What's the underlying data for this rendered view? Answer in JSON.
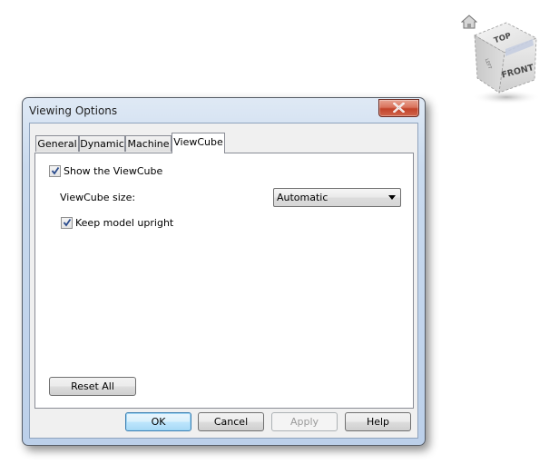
{
  "viewcube": {
    "top_label": "TOP",
    "front_label": "FRONT",
    "left_label": "LEFT",
    "home_icon": "home-icon"
  },
  "dialog": {
    "title": "Viewing Options",
    "close_icon": "close-icon",
    "tabs": [
      {
        "label": "General",
        "active": false
      },
      {
        "label": "Dynamic",
        "active": false
      },
      {
        "label": "Machine",
        "active": false
      },
      {
        "label": "ViewCube",
        "active": true
      }
    ],
    "panel": {
      "show_viewcube": {
        "label": "Show the ViewCube",
        "checked": true
      },
      "size_label": "ViewCube size:",
      "size_select": {
        "value": "Automatic"
      },
      "keep_upright": {
        "label": "Keep model upright",
        "checked": true
      },
      "reset_button": "Reset All"
    },
    "buttons": {
      "ok": "OK",
      "cancel": "Cancel",
      "apply": "Apply",
      "help": "Help"
    }
  }
}
